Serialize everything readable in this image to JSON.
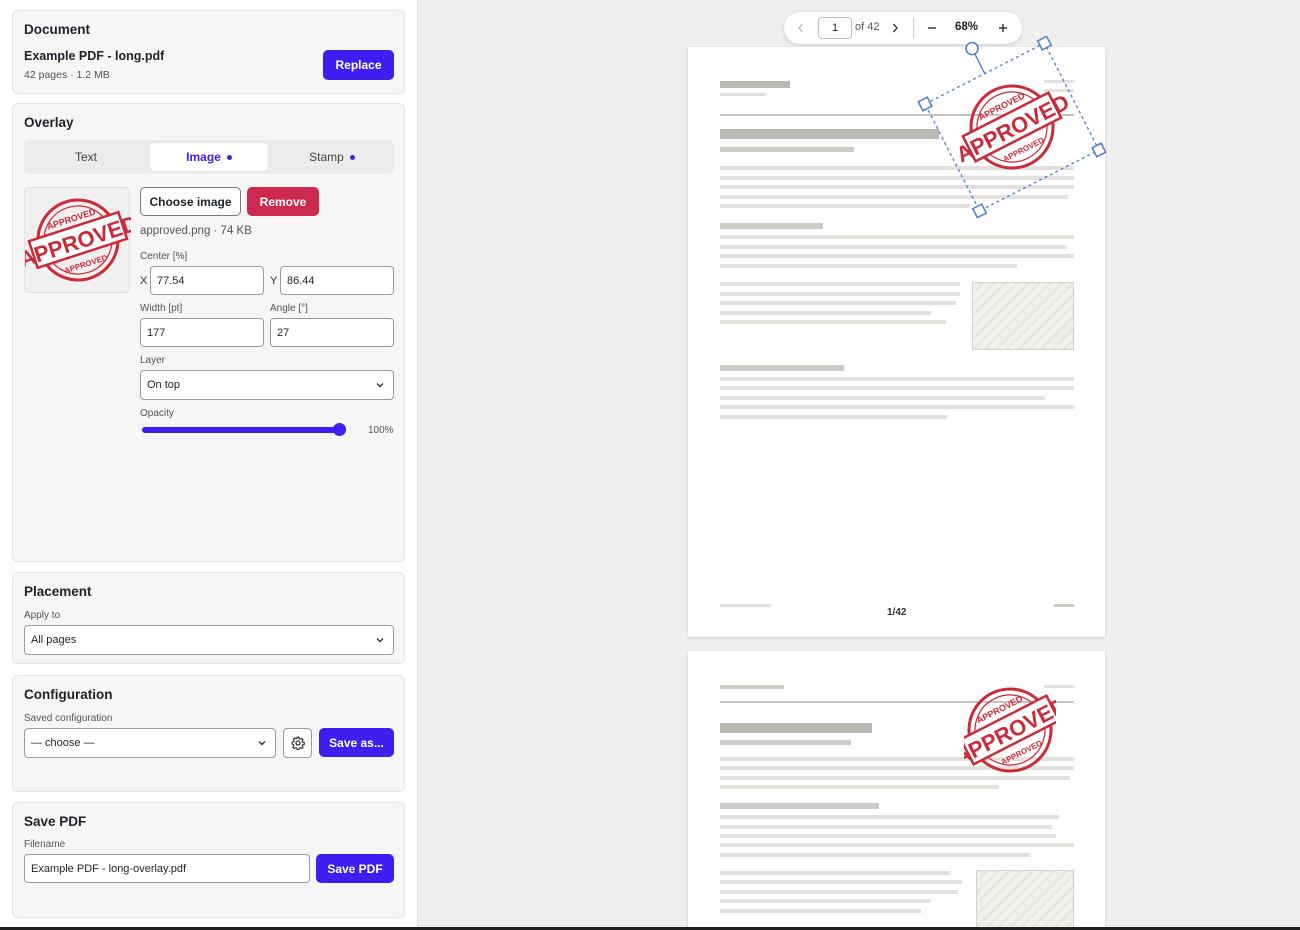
{
  "document": {
    "title": "Document",
    "filename": "Example PDF - long.pdf",
    "meta": "42 pages · 1.2 MB",
    "replace_label": "Replace"
  },
  "overlay": {
    "title": "Overlay",
    "tabs": [
      {
        "label": "Text"
      },
      {
        "label": "Image"
      },
      {
        "label": "Stamp"
      }
    ],
    "choose_label": "Choose image",
    "remove_label": "Remove",
    "image_info": "approved.png · 74 KB",
    "center_label": "Center [%]",
    "x_label": "X",
    "x_value": "77.54",
    "y_label": "Y",
    "y_value": "86.44",
    "width_label": "Width [pt]",
    "width_value": "177",
    "angle_label": "Angle [°]",
    "angle_value": "27",
    "layer_label": "Layer",
    "layer_value": "On top",
    "opacity_label": "Opacity",
    "opacity_value": "100%",
    "opacity_fraction": 1.0
  },
  "placement": {
    "title": "Placement",
    "apply_label": "Apply to",
    "apply_value": "All pages"
  },
  "configuration": {
    "title": "Configuration",
    "saved_label": "Saved configuration",
    "saved_value": "— choose —",
    "save_as_label": "Save as..."
  },
  "save": {
    "title": "Save PDF",
    "filename_label": "Filename",
    "filename_value": "Example PDF - long-overlay.pdf",
    "save_label": "Save PDF"
  },
  "viewer": {
    "page_value": "1",
    "page_total": "of 42",
    "zoom": "68%",
    "page_footer": "1/42"
  },
  "stamp": {
    "top_text": "APPROVED",
    "main_text": "APPROVED",
    "bottom_text": "APPROVED",
    "color": "#cc2a36"
  },
  "colors": {
    "accent": "#3e1ef0",
    "danger": "#cc2a4f",
    "selection": "#4a7bd8"
  }
}
